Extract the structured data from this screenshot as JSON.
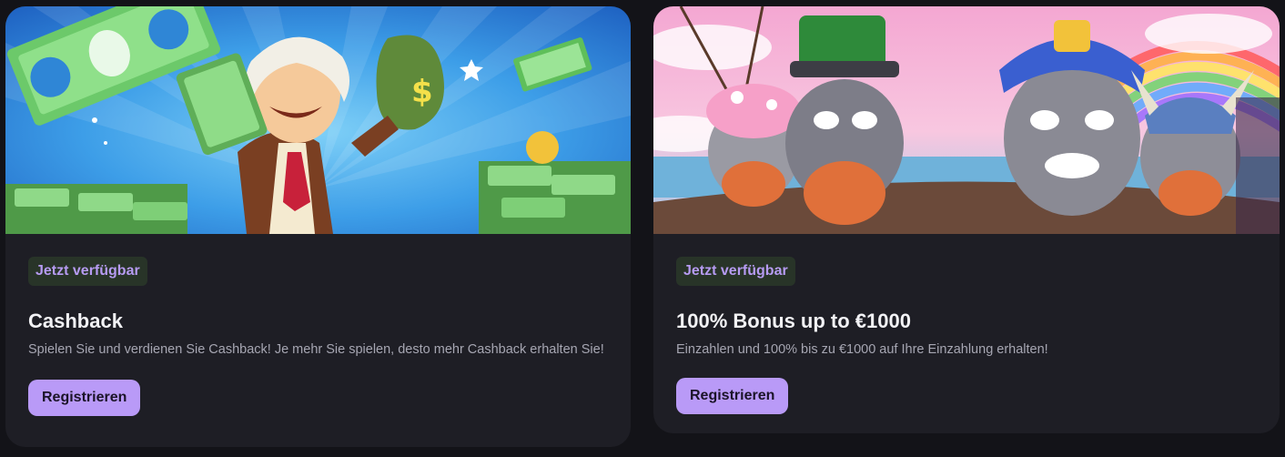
{
  "cards": [
    {
      "badge": "Jetzt verfügbar",
      "title": "Cashback",
      "description": "Spielen Sie und verdienen Sie Cashback! Je mehr Sie spielen, desto mehr Cashback erhalten Sie!",
      "button_label": "Registrieren",
      "illustration": "cashback-cartoon-money-man"
    },
    {
      "badge": "Jetzt verfügbar",
      "title": "100% Bonus up to €1000",
      "description": "Einzahlen und 100% bis zu €1000 auf Ihre Einzahlung erhalten!",
      "button_label": "Registrieren",
      "illustration": "raccoon-crew-bonus-banner"
    }
  ],
  "colors": {
    "page_bg": "#131318",
    "card_bg": "#1e1e25",
    "badge_bg": "#283428",
    "badge_text": "#b69bf2",
    "button_bg": "#b99af7",
    "title_text": "#f2f2f5",
    "desc_text": "#a6a6b2"
  }
}
